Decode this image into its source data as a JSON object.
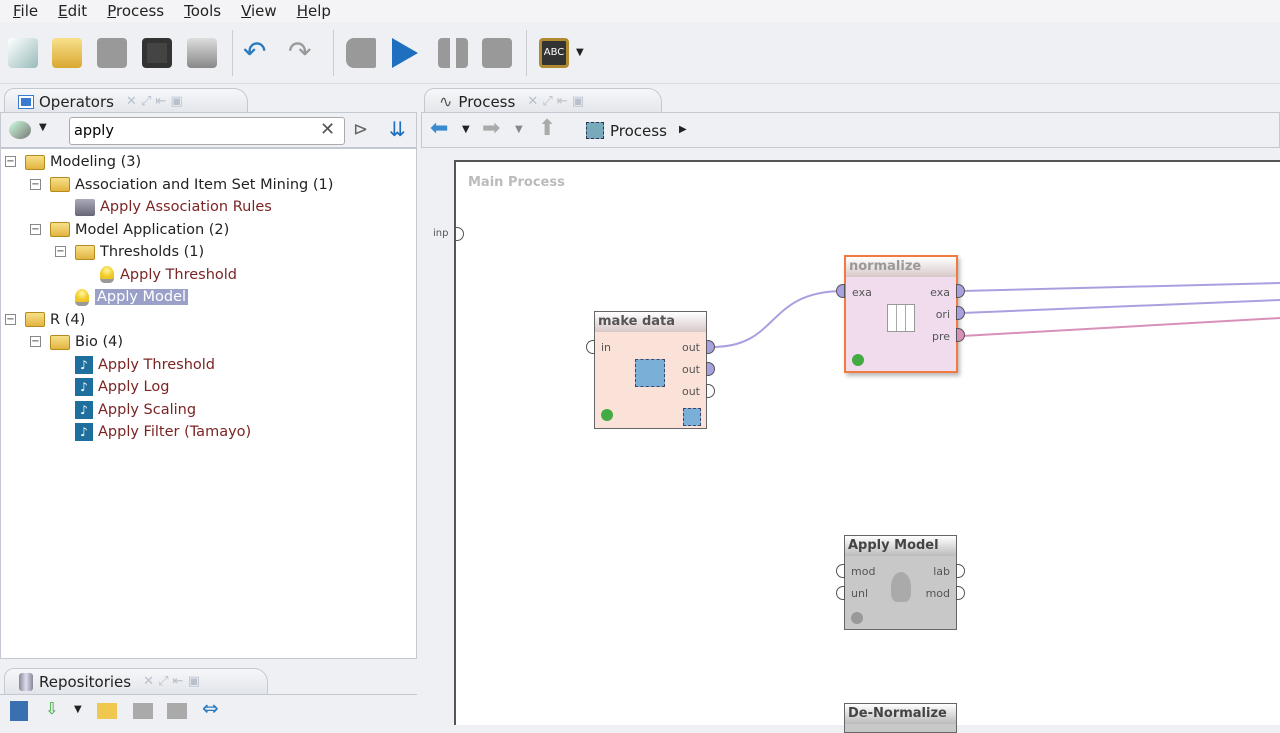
{
  "menu": [
    "File",
    "Edit",
    "Process",
    "Tools",
    "View",
    "Help"
  ],
  "operators_panel": {
    "title": "Operators",
    "search_value": "apply",
    "tree": [
      {
        "label": "Modeling (3)",
        "level": 0,
        "type": "folder"
      },
      {
        "label": "Association and Item Set Mining (1)",
        "level": 1,
        "type": "folder"
      },
      {
        "label": "Apply Association Rules",
        "level": 2,
        "type": "operator"
      },
      {
        "label": "Model Application (2)",
        "level": 1,
        "type": "folder"
      },
      {
        "label": "Thresholds (1)",
        "level": 2,
        "type": "folder"
      },
      {
        "label": "Apply Threshold",
        "level": 3,
        "type": "bulb"
      },
      {
        "label": "Apply Model",
        "level": 2,
        "type": "bulb",
        "selected": true
      },
      {
        "label": "R (4)",
        "level": 0,
        "type": "folder"
      },
      {
        "label": "Bio (4)",
        "level": 1,
        "type": "folder"
      },
      {
        "label": "Apply Threshold",
        "level": 2,
        "type": "r"
      },
      {
        "label": "Apply Log",
        "level": 2,
        "type": "r"
      },
      {
        "label": "Apply Scaling",
        "level": 2,
        "type": "r"
      },
      {
        "label": "Apply Filter (Tamayo)",
        "level": 2,
        "type": "r"
      }
    ]
  },
  "repositories_panel": {
    "title": "Repositories"
  },
  "process_panel": {
    "title": "Process",
    "breadcrumb": "Process",
    "canvas_title": "Main Process",
    "input_port": "inp"
  },
  "nodes": {
    "make_data": {
      "title": "make data",
      "in": "in",
      "outs": [
        "out",
        "out",
        "out"
      ]
    },
    "normalize": {
      "title": "normalize",
      "in": "exa",
      "outs": [
        "exa",
        "ori",
        "pre"
      ]
    },
    "apply_model": {
      "title": "Apply Model",
      "ins": [
        "mod",
        "unl"
      ],
      "outs": [
        "lab",
        "mod"
      ]
    },
    "de_normalize": {
      "title": "De-Normalize"
    }
  },
  "colors": {
    "selection": "#9aa0c8",
    "wire": "#a9a0e0",
    "wire_pre": "#d890b8",
    "leaf_text": "#7b2424"
  }
}
